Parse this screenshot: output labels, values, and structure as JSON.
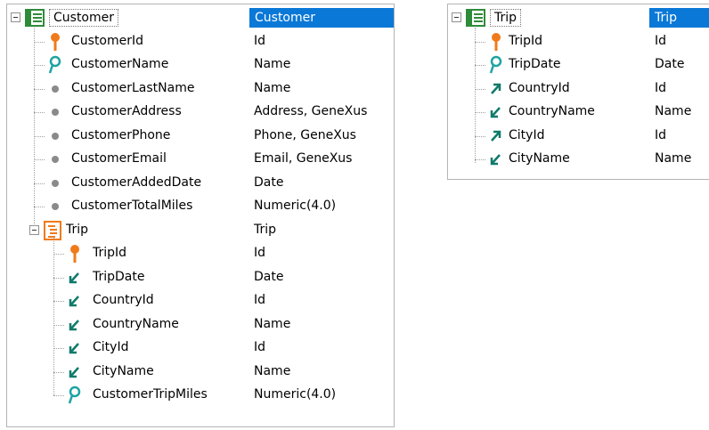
{
  "customer_panel": {
    "root": {
      "label": "Customer",
      "type": "Customer"
    },
    "attributes": [
      {
        "name": "CustomerId",
        "type": "Id",
        "icon": "key-icon"
      },
      {
        "name": "CustomerName",
        "type": "Name",
        "icon": "search-key-icon"
      },
      {
        "name": "CustomerLastName",
        "type": "Name",
        "icon": "attribute-dot-icon"
      },
      {
        "name": "CustomerAddress",
        "type": "Address, GeneXus",
        "icon": "attribute-dot-icon"
      },
      {
        "name": "CustomerPhone",
        "type": "Phone, GeneXus",
        "icon": "attribute-dot-icon"
      },
      {
        "name": "CustomerEmail",
        "type": "Email, GeneXus",
        "icon": "attribute-dot-icon"
      },
      {
        "name": "CustomerAddedDate",
        "type": "Date",
        "icon": "attribute-dot-icon"
      },
      {
        "name": "CustomerTotalMiles",
        "type": "Numeric(4.0)",
        "icon": "attribute-dot-icon"
      }
    ],
    "level": {
      "label": "Trip",
      "type": "Trip"
    },
    "level_attributes": [
      {
        "name": "TripId",
        "type": "Id",
        "icon": "key-icon"
      },
      {
        "name": "TripDate",
        "type": "Date",
        "icon": "inferred-arrow-icon"
      },
      {
        "name": "CountryId",
        "type": "Id",
        "icon": "inferred-arrow-icon"
      },
      {
        "name": "CountryName",
        "type": "Name",
        "icon": "inferred-arrow-icon"
      },
      {
        "name": "CityId",
        "type": "Id",
        "icon": "inferred-arrow-icon"
      },
      {
        "name": "CityName",
        "type": "Name",
        "icon": "inferred-arrow-icon"
      },
      {
        "name": "CustomerTripMiles",
        "type": "Numeric(4.0)",
        "icon": "search-key-icon"
      }
    ]
  },
  "trip_panel": {
    "root": {
      "label": "Trip",
      "type": "Trip"
    },
    "attributes": [
      {
        "name": "TripId",
        "type": "Id",
        "icon": "key-icon"
      },
      {
        "name": "TripDate",
        "type": "Date",
        "icon": "search-key-icon"
      },
      {
        "name": "CountryId",
        "type": "Id",
        "icon": "foreign-key-arrow-icon"
      },
      {
        "name": "CountryName",
        "type": "Name",
        "icon": "inferred-arrow-icon"
      },
      {
        "name": "CityId",
        "type": "Id",
        "icon": "foreign-key-arrow-icon"
      },
      {
        "name": "CityName",
        "type": "Name",
        "icon": "inferred-arrow-icon"
      }
    ]
  },
  "colors": {
    "selection": "#0a78d7",
    "key": "#f07a1a",
    "search_key": "#1fa3a3",
    "arrow": "#0f7a6a",
    "dot": "#8a8a8a",
    "table_icon": "#2e8b3a",
    "level_icon": "#f07a1a"
  }
}
